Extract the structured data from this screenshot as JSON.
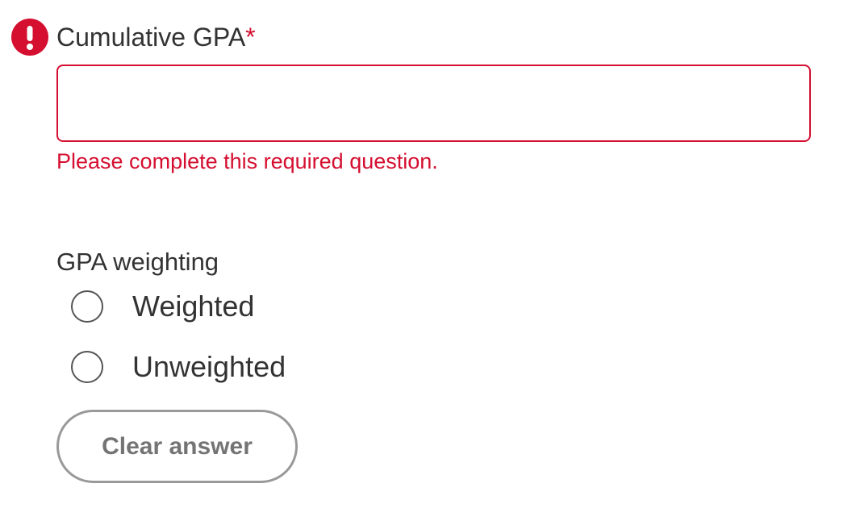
{
  "question": {
    "label": "Cumulative GPA",
    "required_mark": "*",
    "input_value": "",
    "error_message": "Please complete this required question.",
    "error_icon": "exclamation-circle-icon"
  },
  "weighting": {
    "label": "GPA weighting",
    "options": [
      {
        "label": "Weighted",
        "selected": false
      },
      {
        "label": "Unweighted",
        "selected": false
      }
    ],
    "clear_label": "Clear answer"
  },
  "colors": {
    "error": "#d50f30",
    "text": "#333333",
    "button_border": "#999999",
    "button_text": "#747474"
  }
}
